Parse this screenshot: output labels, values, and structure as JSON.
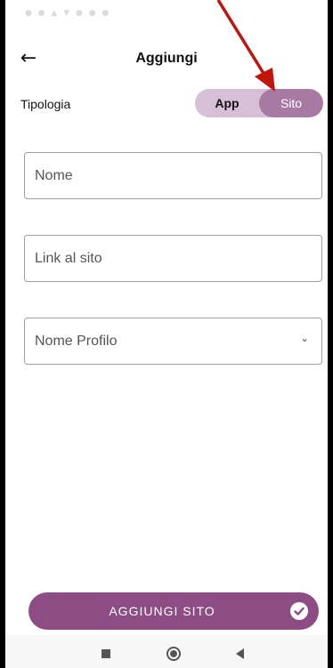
{
  "app_bar": {
    "back_icon": "arrow-left-icon",
    "title": "Aggiungi"
  },
  "type_selector": {
    "label": "Tipologia",
    "options": [
      "App",
      "Sito"
    ],
    "selected": "Sito"
  },
  "form": {
    "name_placeholder": "Nome",
    "link_placeholder": "Link al sito",
    "profile_label": "Nome Profilo",
    "profile_icon": "chevron-down-icon"
  },
  "submit": {
    "label": "AGGIUNGI SITO",
    "icon": "check-circle-icon"
  },
  "colors": {
    "accent": "#8e4c85",
    "segment_bg": "#d8bfd8",
    "segment_selected": "#a77aa4",
    "annotation": "#c0140c"
  }
}
